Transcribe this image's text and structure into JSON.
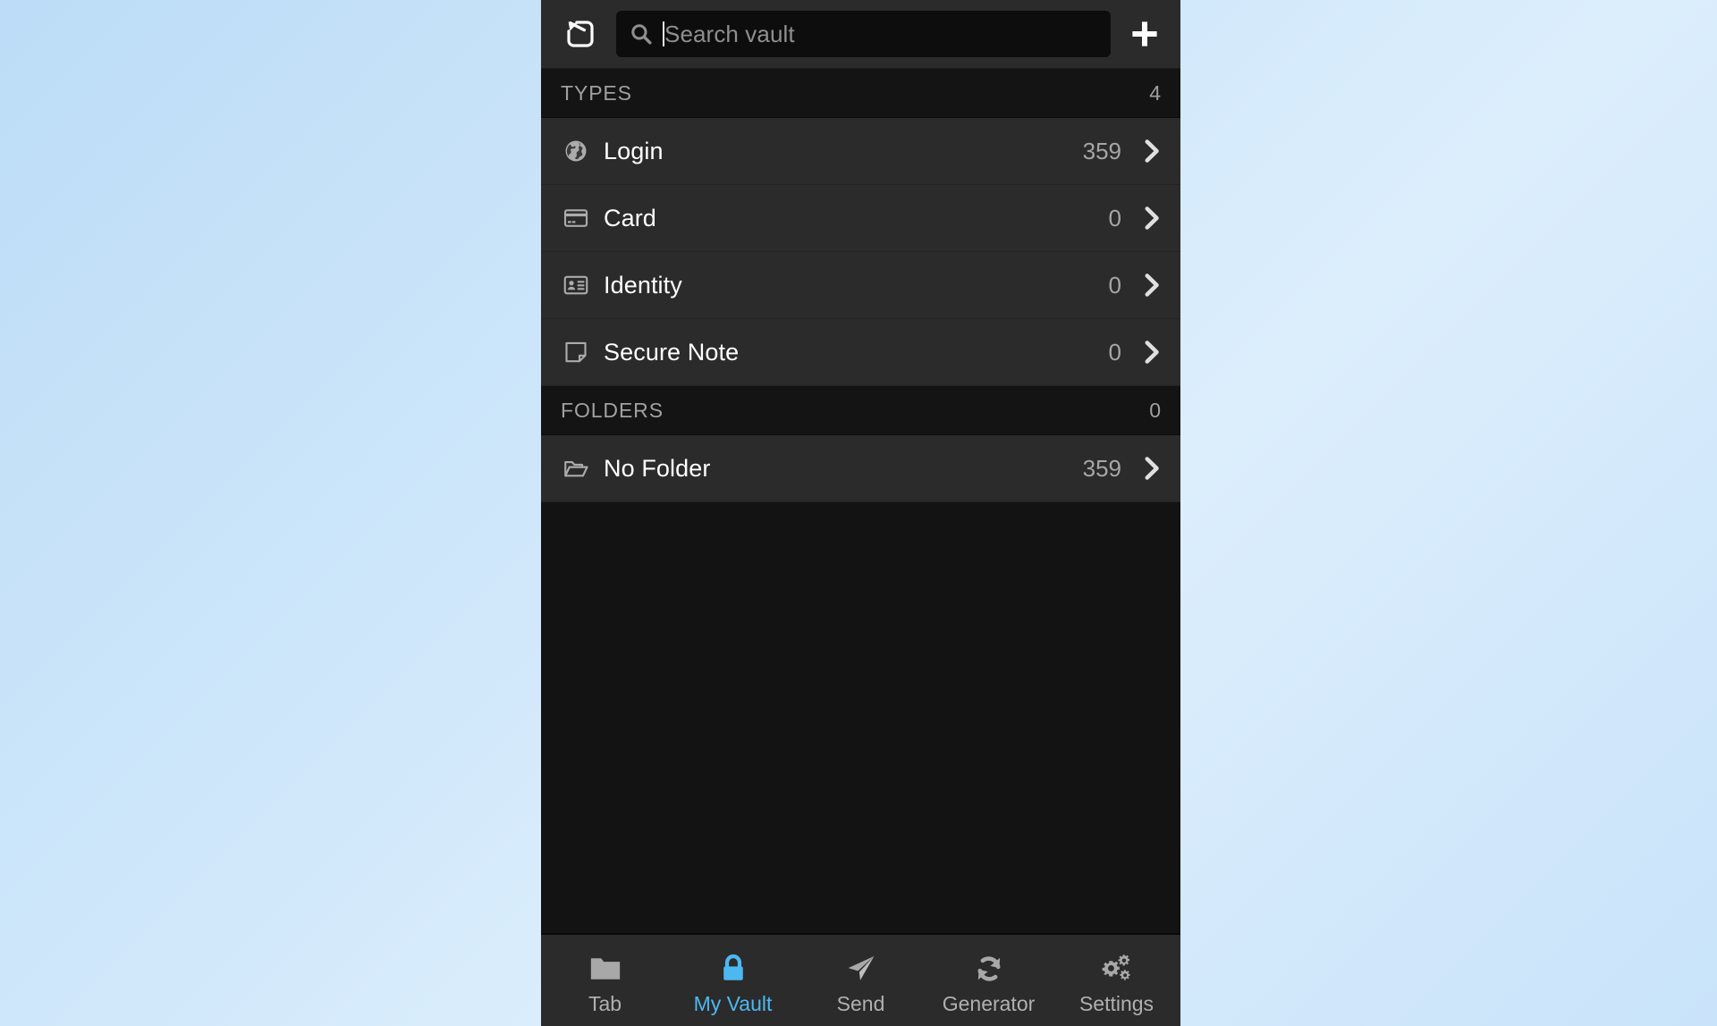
{
  "app": {
    "name": "Bitwarden Browser Extension",
    "theme_accent": "#4db8f0",
    "panel_bg": "#131313",
    "row_bg": "#2b2b2b",
    "page_bg": "#cde6fa"
  },
  "top_bar": {
    "popout_icon": "pop-out-icon",
    "add_icon": "plus-icon",
    "search": {
      "icon": "search-icon",
      "placeholder": "Search vault",
      "value": "",
      "caret_visible": true
    }
  },
  "sections": [
    {
      "key": "types",
      "title": "TYPES",
      "count": "4",
      "rows": [
        {
          "icon": "globe-icon",
          "label": "Login",
          "count": "359",
          "chevron": "chevron-right-icon"
        },
        {
          "icon": "credit-card-icon",
          "label": "Card",
          "count": "0",
          "chevron": "chevron-right-icon"
        },
        {
          "icon": "id-badge-icon",
          "label": "Identity",
          "count": "0",
          "chevron": "chevron-right-icon"
        },
        {
          "icon": "sticky-note-icon",
          "label": "Secure Note",
          "count": "0",
          "chevron": "chevron-right-icon"
        }
      ]
    },
    {
      "key": "folders",
      "title": "FOLDERS",
      "count": "0",
      "rows": [
        {
          "icon": "folder-open-icon",
          "label": "No Folder",
          "count": "359",
          "chevron": "chevron-right-icon"
        }
      ]
    }
  ],
  "bottom_nav": {
    "active": "my-vault",
    "items": [
      {
        "key": "tab",
        "icon": "folder-icon",
        "label": "Tab",
        "active": false
      },
      {
        "key": "my-vault",
        "icon": "lock-icon",
        "label": "My Vault",
        "active": true
      },
      {
        "key": "send",
        "icon": "send-icon",
        "label": "Send",
        "active": false
      },
      {
        "key": "generator",
        "icon": "refresh-icon",
        "label": "Generator",
        "active": false
      },
      {
        "key": "settings",
        "icon": "gears-icon",
        "label": "Settings",
        "active": false
      }
    ]
  }
}
